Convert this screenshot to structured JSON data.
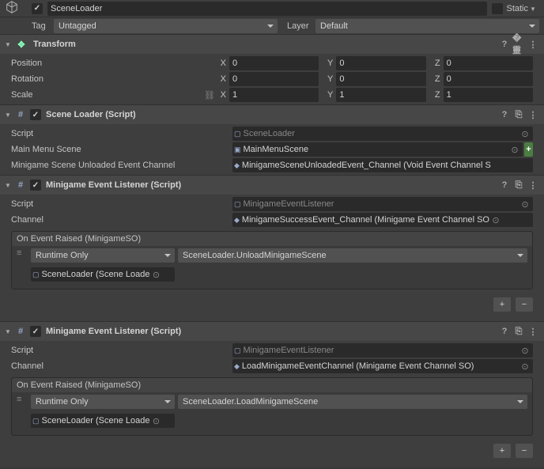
{
  "header": {
    "name_value": "SceneLoader",
    "static_label": "Static",
    "tag_label": "Tag",
    "tag_value": "Untagged",
    "layer_label": "Layer",
    "layer_value": "Default"
  },
  "transform": {
    "title": "Transform",
    "position_label": "Position",
    "rotation_label": "Rotation",
    "scale_label": "Scale",
    "x": "X",
    "y": "Y",
    "z": "Z",
    "pos": {
      "x": "0",
      "y": "0",
      "z": "0"
    },
    "rot": {
      "x": "0",
      "y": "0",
      "z": "0"
    },
    "scl": {
      "x": "1",
      "y": "1",
      "z": "1"
    }
  },
  "sceneLoader": {
    "title": "Scene Loader (Script)",
    "script_label": "Script",
    "script_value": "SceneLoader",
    "mainmenu_label": "Main Menu Scene",
    "mainmenu_value": "MainMenuScene",
    "unloaded_label": "Minigame Scene Unloaded Event Channel",
    "unloaded_value": "MinigameSceneUnloadedEvent_Channel (Void Event Channel S"
  },
  "listener1": {
    "title": "Minigame Event Listener (Script)",
    "script_label": "Script",
    "script_value": "MinigameEventListener",
    "channel_label": "Channel",
    "channel_value": "MinigameSuccessEvent_Channel (Minigame Event Channel SO",
    "event_header": "On Event Raised (MinigameSO)",
    "runtime": "Runtime Only",
    "function": "SceneLoader.UnloadMinigameScene",
    "target": "SceneLoader (Scene Loade"
  },
  "listener2": {
    "title": "Minigame Event Listener (Script)",
    "script_label": "Script",
    "script_value": "MinigameEventListener",
    "channel_label": "Channel",
    "channel_value": "LoadMinigameEventChannel (Minigame Event Channel SO)",
    "event_header": "On Event Raised (MinigameSO)",
    "runtime": "Runtime Only",
    "function": "SceneLoader.LoadMinigameScene",
    "target": "SceneLoader (Scene Loade"
  }
}
